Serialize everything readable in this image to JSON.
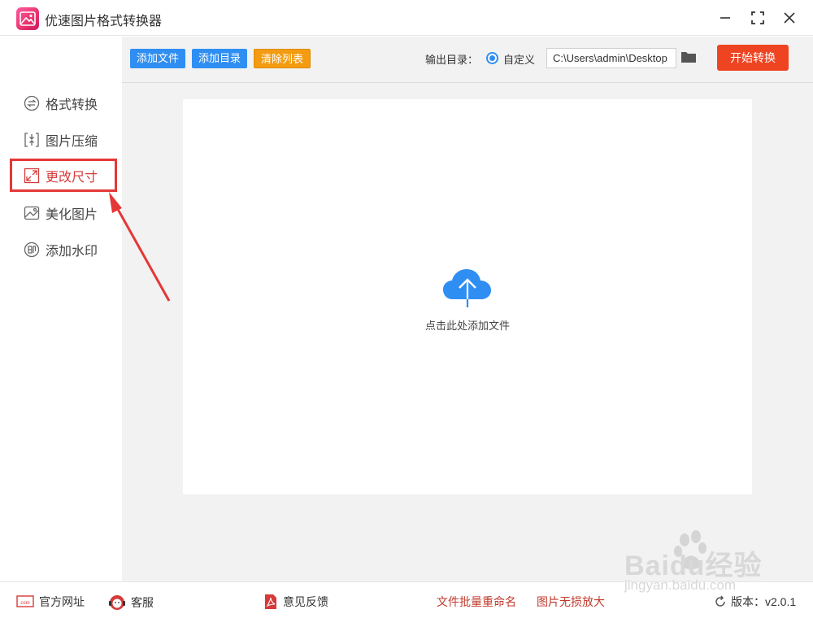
{
  "app": {
    "title": "优速图片格式转换器"
  },
  "window_controls": {
    "minimize": "minimize-icon",
    "maximize": "maximize-icon",
    "close": "close-icon"
  },
  "toolbar": {
    "add_file": "添加文件",
    "add_dir": "添加目录",
    "clear_list": "清除列表",
    "output_label": "输出目录：",
    "radio_label": "自定义",
    "path_value": "C:\\Users\\admin\\Desktop",
    "start_button": "开始转换"
  },
  "sidebar": {
    "items": [
      {
        "label": "格式转换",
        "icon": "swap-icon"
      },
      {
        "label": "图片压缩",
        "icon": "compress-icon"
      },
      {
        "label": "更改尺寸",
        "icon": "resize-icon",
        "active": true
      },
      {
        "label": "美化图片",
        "icon": "beautify-icon"
      },
      {
        "label": "添加水印",
        "icon": "watermark-icon"
      }
    ]
  },
  "main": {
    "drop_text": "点击此处添加文件"
  },
  "footer": {
    "website": "官方网址",
    "service": "客服",
    "feedback": "意见反馈",
    "batch_rename": "文件批量重命名",
    "lossless_enlarge": "图片无损放大",
    "version": "版本：v2.0.1"
  },
  "watermark": {
    "brand": "Baidu经验",
    "url": "jingyan.baidu.com"
  },
  "colors": {
    "accent_blue": "#2f8ef2",
    "clear_orange": "#f39c12",
    "start_red": "#ee4422",
    "highlight_red": "#e43737"
  }
}
